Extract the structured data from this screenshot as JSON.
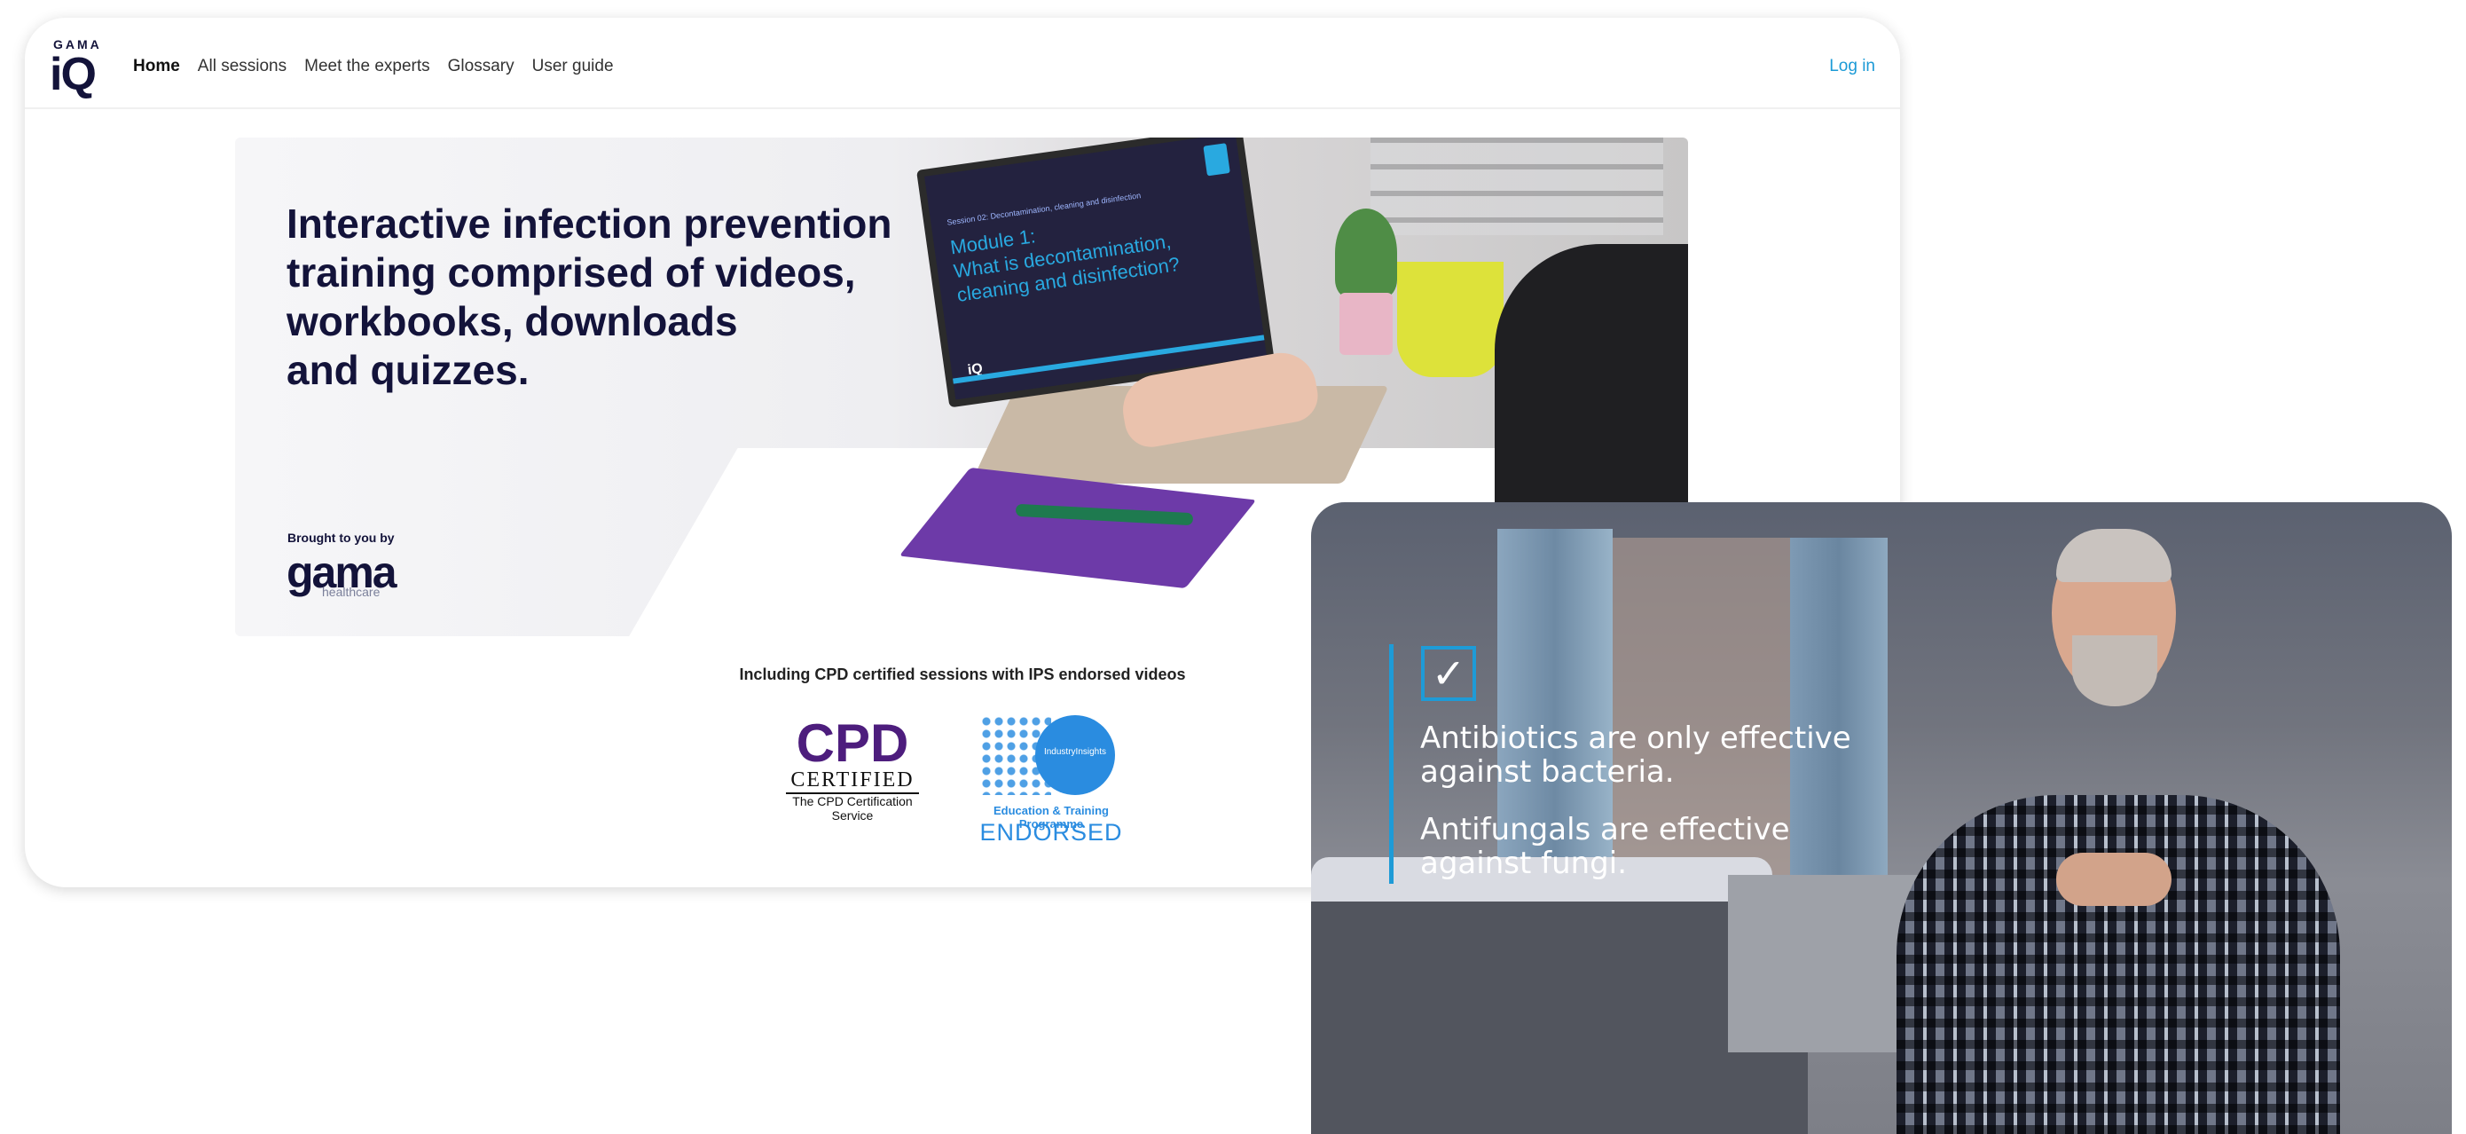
{
  "header": {
    "logo_small": "GAMA",
    "logo_big": "iQ",
    "nav": [
      {
        "label": "Home",
        "active": true
      },
      {
        "label": "All sessions",
        "active": false
      },
      {
        "label": "Meet the experts",
        "active": false
      },
      {
        "label": "Glossary",
        "active": false
      },
      {
        "label": "User guide",
        "active": false
      }
    ],
    "login": "Log in"
  },
  "hero": {
    "title": "Interactive infection prevention\ntraining comprised of videos,\nworkbooks, downloads\nand quizzes.",
    "brought_by": "Brought to you by",
    "brand_word": "gama",
    "brand_sub": "healthcare",
    "screen_session": "Session 02: Decontamination, cleaning and disinfection",
    "screen_module": "Module 1:\nWhat is decontamination,\ncleaning and disinfection?",
    "screen_logo": "iQ"
  },
  "certifications": {
    "text": "Including CPD certified sessions with IPS endorsed videos",
    "cpd": {
      "big": "CPD",
      "certified": "CERTIFIED",
      "service": "The CPD Certification Service"
    },
    "ips": {
      "circle": "IndustryInsights",
      "programme": "Education & Training Programme",
      "endorsed": "ENDORSED"
    }
  },
  "video": {
    "check": "✓",
    "line1": "Antibiotics are only effective\nagainst bacteria.",
    "line2": "Antifungals are effective\nagainst fungi."
  }
}
